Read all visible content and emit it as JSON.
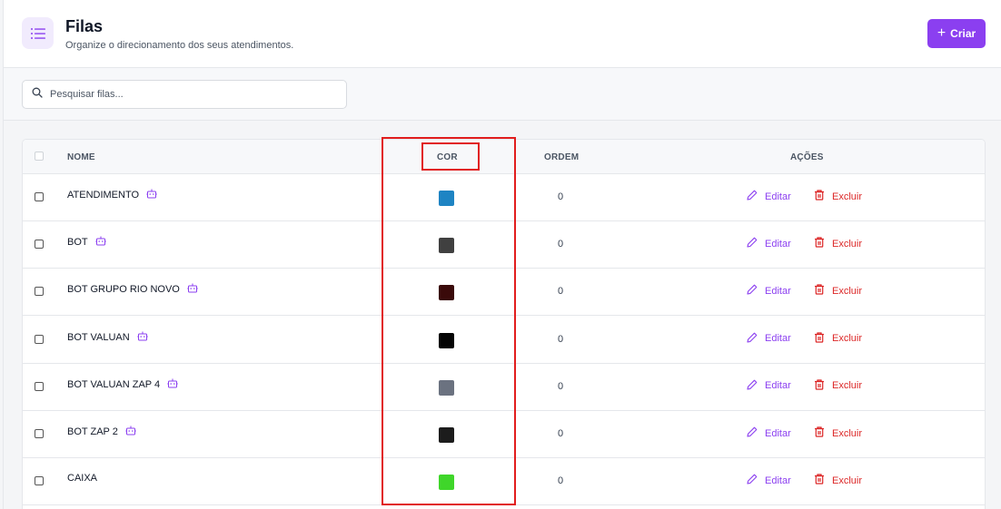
{
  "page": {
    "title": "Filas",
    "subtitle": "Organize o direcionamento dos seus atendimentos.",
    "create_label": "Criar"
  },
  "search": {
    "placeholder": "Pesquisar filas..."
  },
  "table": {
    "headers": {
      "name": "NOME",
      "color": "COR",
      "order": "ORDEM",
      "actions": "AÇÕES"
    },
    "edit_label": "Editar",
    "delete_label": "Excluir",
    "rows": [
      {
        "name": "ATENDIMENTO",
        "bot": true,
        "color": "#1e84c3",
        "order": "0"
      },
      {
        "name": "BOT",
        "bot": true,
        "color": "#404040",
        "order": "0"
      },
      {
        "name": "BOT GRUPO RIO NOVO",
        "bot": true,
        "color": "#3a0a0a",
        "order": "0"
      },
      {
        "name": "BOT VALUAN",
        "bot": true,
        "color": "#050505",
        "order": "0"
      },
      {
        "name": "BOT VALUAN ZAP 4",
        "bot": true,
        "color": "#6b7280",
        "order": "0"
      },
      {
        "name": "BOT ZAP 2",
        "bot": true,
        "color": "#1c1c1c",
        "order": "0"
      },
      {
        "name": "CAIXA",
        "bot": false,
        "color": "#3fd62a",
        "order": "0"
      }
    ]
  },
  "colors": {
    "accent": "#8b3ff0",
    "danger": "#dc2626",
    "highlight": "#e11d1d"
  }
}
